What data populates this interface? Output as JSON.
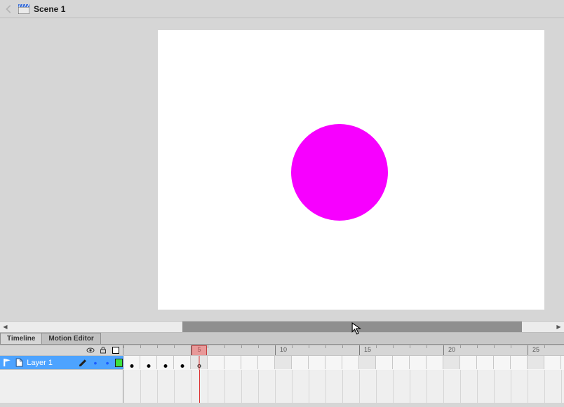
{
  "scene": {
    "title": "Scene 1"
  },
  "tabs": {
    "timeline": "Timeline",
    "motion_editor": "Motion Editor"
  },
  "layer": {
    "name": "Layer 1"
  },
  "ruler": {
    "ticks": [
      {
        "n": 1,
        "label": "",
        "major": false
      },
      {
        "n": 5,
        "label": "5",
        "major": true
      },
      {
        "n": 10,
        "label": "10",
        "major": true
      },
      {
        "n": 15,
        "label": "15",
        "major": true
      },
      {
        "n": 20,
        "label": "20",
        "major": true
      },
      {
        "n": 25,
        "label": "25",
        "major": true
      }
    ]
  },
  "timeline": {
    "frame_width": 24,
    "playhead_frame": 5,
    "frame_count": 26,
    "keyframes": [
      {
        "frame": 1,
        "kind": "key"
      },
      {
        "frame": 2,
        "kind": "key"
      },
      {
        "frame": 3,
        "kind": "key"
      },
      {
        "frame": 4,
        "kind": "key"
      },
      {
        "frame": 5,
        "kind": "open"
      }
    ]
  },
  "icons": {
    "back": "back-arrow-icon",
    "scene": "scene-clapper-icon",
    "eye": "eye-icon",
    "lock": "lock-icon",
    "outline": "outline-square-icon",
    "pencil": "pencil-icon",
    "page": "page-icon",
    "flag": "flag-icon"
  },
  "shape": {
    "fill": "#f700ff"
  }
}
